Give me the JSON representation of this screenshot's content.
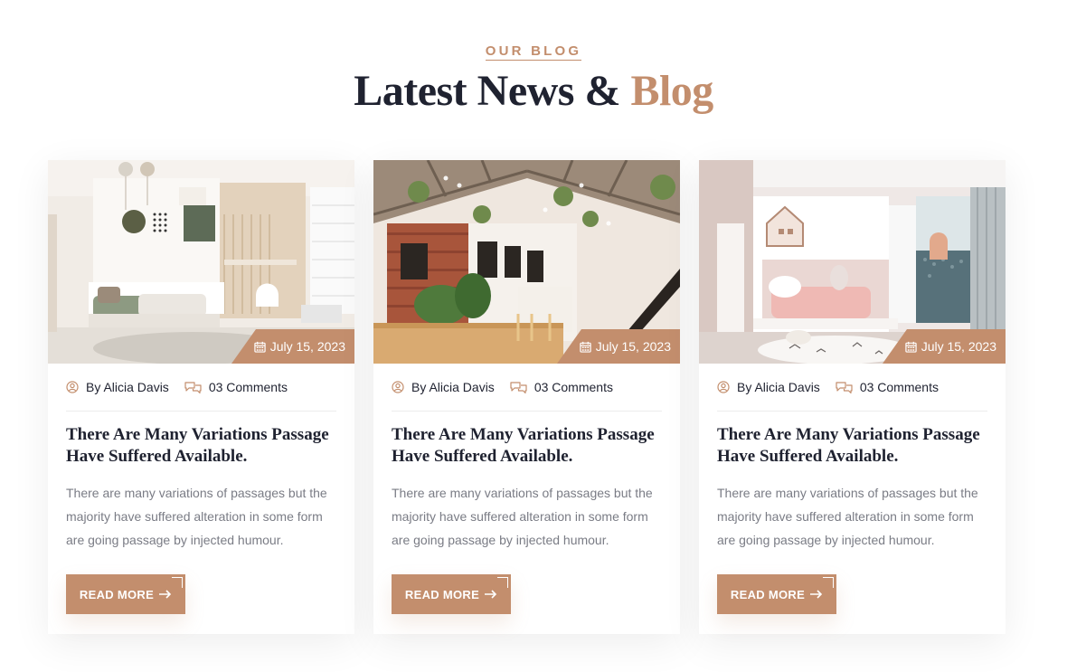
{
  "section": {
    "eyebrow": "OUR BLOG",
    "headline_main": "Latest News &",
    "headline_accent": "Blog"
  },
  "colors": {
    "accent": "#c38e6d",
    "dark": "#1f2230",
    "muted": "#7a7c85"
  },
  "icons": {
    "author": "user-circle-icon",
    "comments": "chat-bubbles-icon",
    "date": "calendar-icon",
    "button": "arrow-right-icon"
  },
  "posts": [
    {
      "image": "kids-bedroom-bunk",
      "date": "July 15, 2023",
      "author": "By Alicia Davis",
      "comments": "03 Comments",
      "title": "There Are Many Variations Passage Have Suffered Available.",
      "excerpt": "There are many variations of passages but the majority have suffered alteration in some form are going passage by injected humour.",
      "button": "READ MORE"
    },
    {
      "image": "cafe-plants-interior",
      "date": "July 15, 2023",
      "author": "By Alicia Davis",
      "comments": "03 Comments",
      "title": "There Are Many Variations Passage Have Suffered Available.",
      "excerpt": "There are many variations of passages but the majority have suffered alteration in some form are going passage by injected humour.",
      "button": "READ MORE"
    },
    {
      "image": "pink-kids-room",
      "date": "July 15, 2023",
      "author": "By Alicia Davis",
      "comments": "03 Comments",
      "title": "There Are Many Variations Passage Have Suffered Available.",
      "excerpt": "There are many variations of passages but the majority have suffered alteration in some form are going passage by injected humour.",
      "button": "READ MORE"
    }
  ]
}
